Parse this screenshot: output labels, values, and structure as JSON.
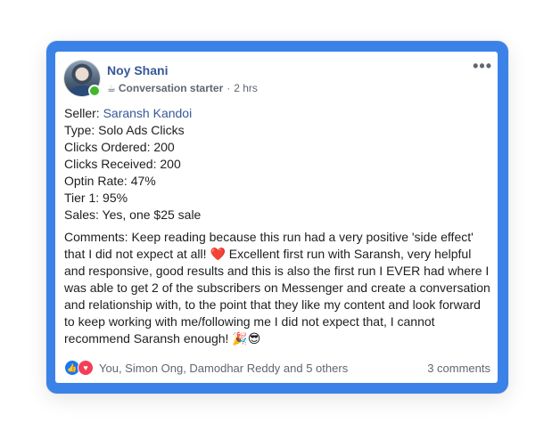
{
  "post": {
    "author": "Noy Shani",
    "badge_icon": "☕",
    "badge": "Conversation starter",
    "time": "2 hrs",
    "more_icon": "•••"
  },
  "details": {
    "seller_label": "Seller:",
    "seller_name": "Saransh Kandoi",
    "type": "Type: Solo Ads Clicks",
    "clicks_ordered": "Clicks Ordered: 200",
    "clicks_received": "Clicks Received: 200",
    "optin_rate": "Optin Rate: 47%",
    "tier": "Tier 1: 95%",
    "sales": "Sales: Yes, one $25 sale"
  },
  "comments_text": {
    "part1": "Comments: Keep reading because this run had a very positive 'side effect' that I did not expect at all!",
    "heart": "❤️",
    "part2": "Excellent first run with Saransh, very helpful and responsive, good results and this is also the first run I EVER had where I was able to get 2 of the subscribers on Messenger and create a conversation and relationship with, to the point that they like my content and look forward to keep working with me/following me I did not expect that, I cannot recommend Saransh enough!",
    "emojis": "🎉😎"
  },
  "footer": {
    "like_icon": "👍",
    "love_icon": "♥",
    "reactors": "You, Simon Ong, Damodhar Reddy and 5 others",
    "comments_count": "3 comments"
  }
}
